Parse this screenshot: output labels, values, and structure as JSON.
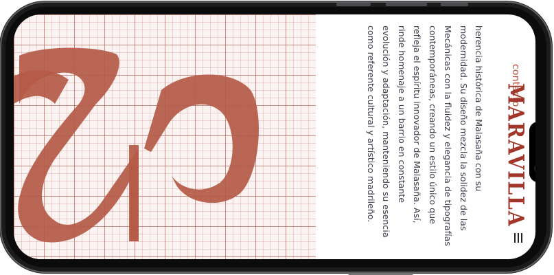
{
  "site": {
    "contact_label": "contacto",
    "brand": "MARAVILLA",
    "paragraph": "herencia histórica de Malasaña con su modernidad. Su diseño mezcla la solidez de las Mecánicas con la fluidez y elegancia de tipografías contemporáneas, creando un estilo único que refleja el espíritu innovador de Malasaña. Así, rinde homenaje a un barrio en constante evolución y adaptación, manteniendo su esencia como referente cultural y artístico madrileño."
  },
  "icons": {
    "menu": "hamburger-menu-icon",
    "art": "ampersand-glyph"
  },
  "colors": {
    "accent": "#b5503b",
    "brand": "#a2362a",
    "glyph": "#b45a48",
    "text": "#3b3a4a"
  }
}
